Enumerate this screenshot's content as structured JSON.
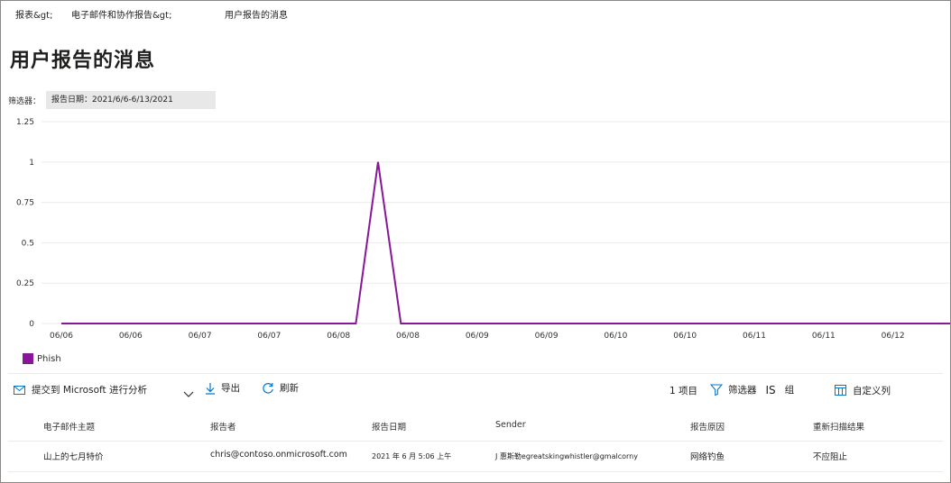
{
  "breadcrumb": {
    "item1": "报表&gt;",
    "item2": "电子邮件和协作报告&gt;",
    "item3": "用户报告的消息"
  },
  "page_title": "用户报告的消息",
  "filter": {
    "label": "筛选器：",
    "chip": "报告日期：2021/6/6-6/13/2021"
  },
  "chart_data": {
    "type": "line",
    "x": [
      "06/06",
      "06/06",
      "06/07",
      "06/07",
      "06/08",
      "06/08",
      "06/09",
      "06/09",
      "06/10",
      "06/10",
      "06/11",
      "06/11",
      "06/12"
    ],
    "yticks": [
      "1.25",
      "1",
      "0.75",
      "0.5",
      "0.25",
      "0"
    ],
    "ylim": [
      0,
      1.25
    ],
    "series": [
      {
        "name": "Phish",
        "color": "#881798",
        "points": [
          [
            0,
            0
          ],
          [
            4.25,
            0
          ],
          [
            4.57,
            1
          ],
          [
            4.9,
            0
          ],
          [
            12.87,
            0
          ]
        ]
      }
    ],
    "legend": "bottom-left",
    "grid": true
  },
  "toolbar": {
    "submit_label": "提交到 Microsoft 进行分析",
    "export_label": "导出",
    "refresh_label": "刷新",
    "count_label": "1 项目",
    "filter_label": "筛选器",
    "is_label": "IS",
    "group_label": "组",
    "customize_label": "自定义列"
  },
  "table": {
    "headers": [
      "电子邮件主题",
      "报告者",
      "报告日期",
      "Sender",
      "报告原因",
      "重新扫描结果"
    ],
    "rows": [
      [
        "山上的七月特价",
        "chris@contoso.onmicrosoft.com",
        "2021 年 6 月  5:06 上午",
        "J 惠斯勒egreatskingwhistler@gmalcorny",
        "网络钓鱼",
        "不应阻止"
      ]
    ]
  }
}
